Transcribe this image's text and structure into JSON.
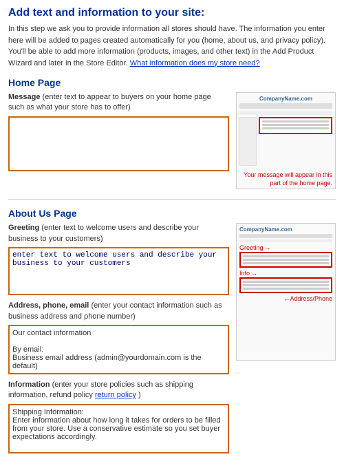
{
  "page": {
    "title": "Add text and information to your site:",
    "intro": "In this step we ask you to provide information all stores should have. The information you enter here will be added to pages created automatically for you (home, about us, and privacy policy). You'll be able to add more information (products, images, and other text) in the Add Product Wizard and later in the Store Editor.",
    "intro_link": "What information does my store need?",
    "sections": [
      {
        "id": "home-page",
        "title": "Home Page",
        "fields": [
          {
            "id": "home-message",
            "label": "Message",
            "label_detail": "(enter text to appear to buyers on your home page such as what your store has to offer)",
            "label_link": null,
            "placeholder": "",
            "value": "",
            "rows": 5
          }
        ],
        "preview": {
          "type": "home",
          "arrow_text": "Your message will appear in this part of the home page."
        }
      },
      {
        "id": "about-us-page",
        "title": "About Us Page",
        "fields": [
          {
            "id": "greeting",
            "label": "Greeting",
            "label_detail": "(enter text to welcome users and describe your business to your customers)",
            "label_link": null,
            "placeholder": "enter text to welcome users and describe your business to your customers",
            "value": "enter text to welcome users and describe your business to your customers",
            "rows": 4
          },
          {
            "id": "address-phone-email",
            "label": "Address, phone, email",
            "label_detail": "(enter your contact information such as business address and phone number)",
            "label_link": null,
            "placeholder": "",
            "value": "Our contact information\n\nBy email:\nBusiness email address (admin@yourdomain.com is the default)",
            "rows": 5
          },
          {
            "id": "information",
            "label": "Information",
            "label_detail": "(enter your store policies such as shipping information, refund policy",
            "label_link": "return policy",
            "placeholder": "",
            "value": "Shipping Information:\nEnter information about how long it takes for orders to be filled from your store. Use a conservative estimate so you set buyer expectations accordingly.",
            "rows": 5
          }
        ],
        "preview": {
          "type": "about",
          "greeting_label": "Greeting",
          "info_label": "←Address/Phone",
          "info_label2": "Info"
        }
      }
    ]
  }
}
